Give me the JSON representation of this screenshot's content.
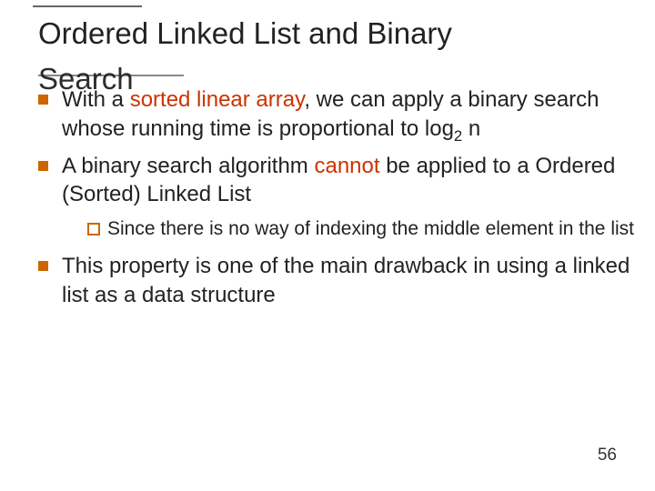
{
  "title_line1": "Ordered Linked List and Binary",
  "title_line2_overlap": "Search",
  "bullets": {
    "b1_pre": "With a ",
    "b1_red": "sorted linear array",
    "b1_mid": ", we can apply a binary search whose running time is proportional to log",
    "b1_sub": "2",
    "b1_post": " n",
    "b2_pre": "A binary search algorithm ",
    "b2_red": "cannot",
    "b2_post": " be applied to a Ordered (Sorted) Linked List",
    "b2_sub1": "Since there is no way of indexing the middle element in the list",
    "b3": "This property is one of the main drawback in using a linked list as a data structure"
  },
  "page_number": "56"
}
